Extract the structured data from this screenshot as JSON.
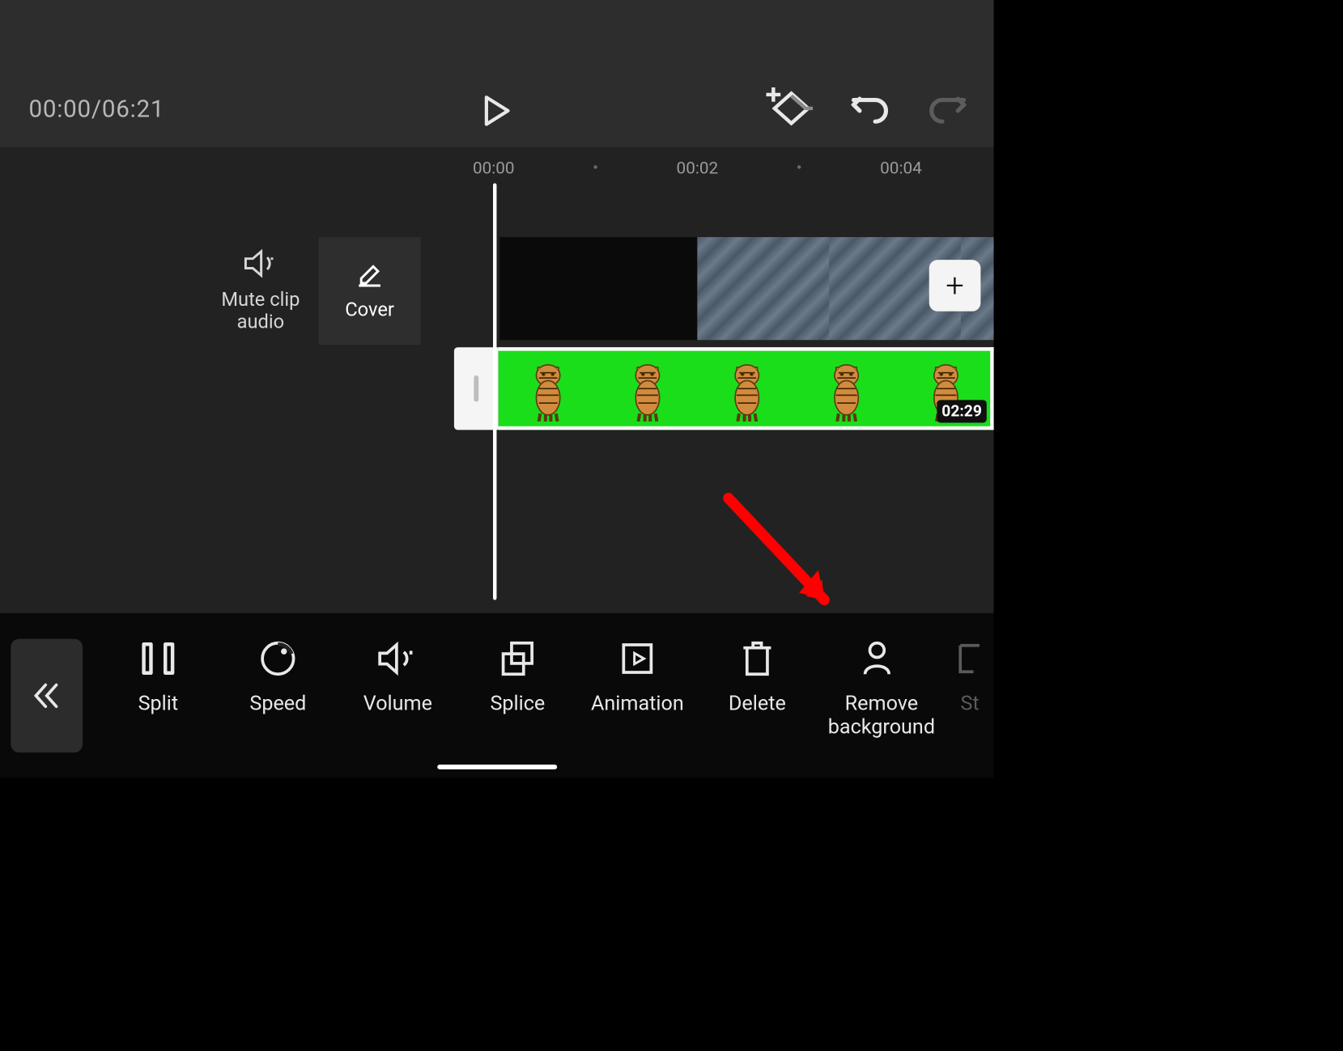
{
  "playback": {
    "current": "00:00",
    "total": "06:21",
    "display": "00:00/06:21"
  },
  "ruler": {
    "ticks": [
      "00:00",
      "00:02",
      "00:04"
    ]
  },
  "side_actions": {
    "mute": {
      "label": "Mute clip audio"
    },
    "cover": {
      "label": "Cover"
    }
  },
  "overlay_clip": {
    "duration": "02:29",
    "subject": "tiger",
    "bg_color": "#1ade1a"
  },
  "add_media": {
    "label": "+"
  },
  "toolbar": {
    "items": [
      {
        "id": "split",
        "label": "Split"
      },
      {
        "id": "speed",
        "label": "Speed"
      },
      {
        "id": "volume",
        "label": "Volume"
      },
      {
        "id": "splice",
        "label": "Splice"
      },
      {
        "id": "animation",
        "label": "Animation"
      },
      {
        "id": "delete",
        "label": "Delete"
      },
      {
        "id": "remove-background",
        "label": "Remove background"
      },
      {
        "id": "style",
        "label": "St"
      }
    ]
  }
}
